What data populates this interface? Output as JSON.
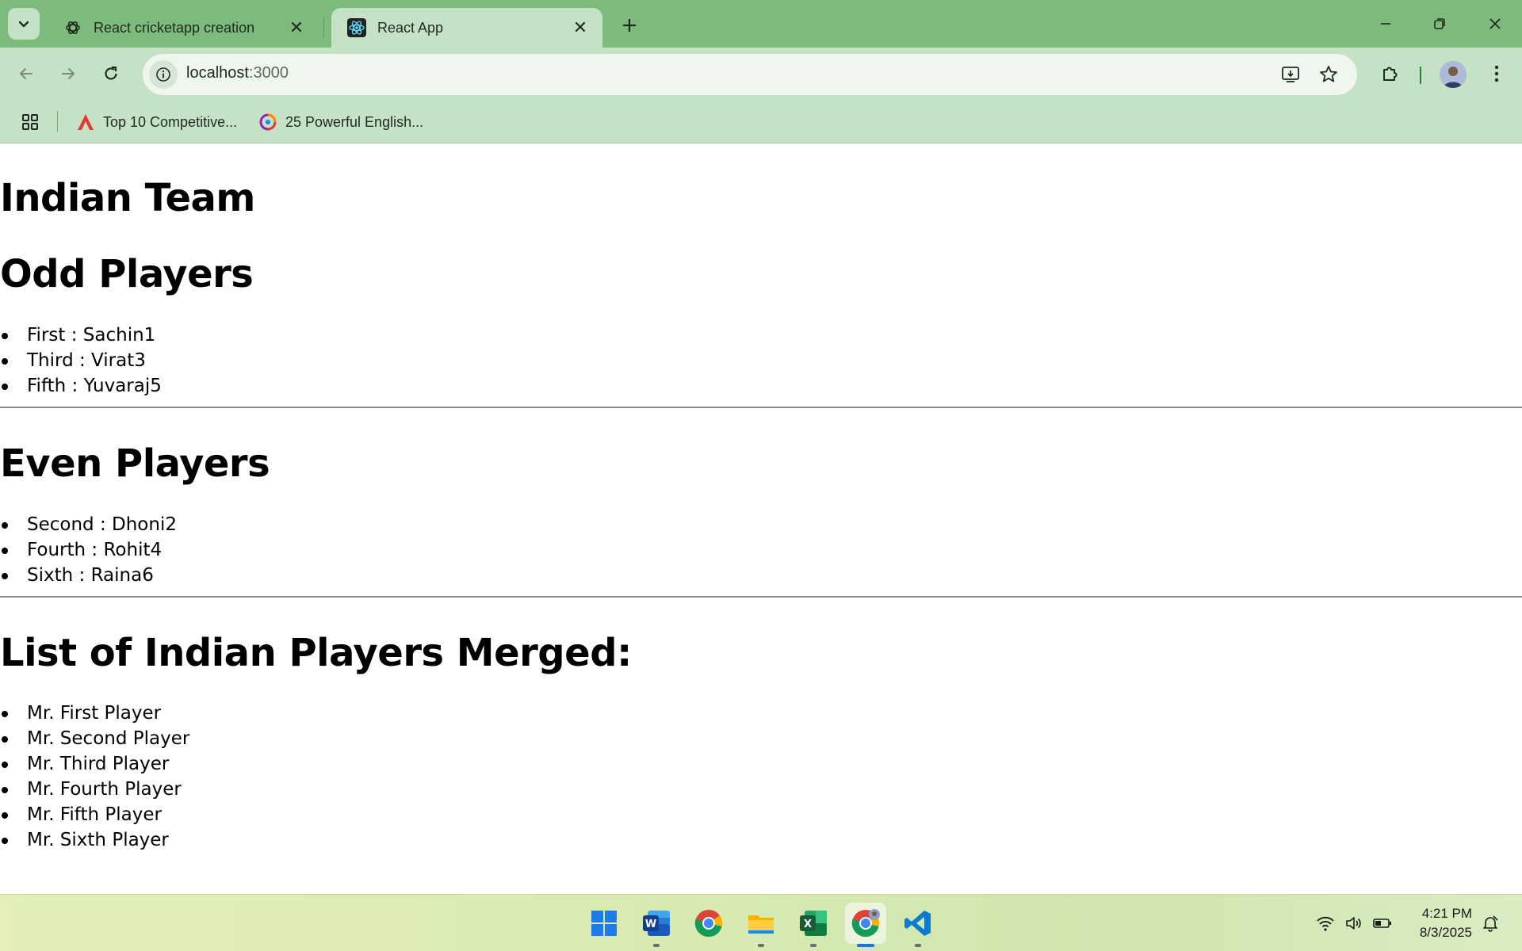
{
  "browser": {
    "tabs": [
      {
        "title": "React cricketapp creation",
        "favicon": "openai-icon",
        "active": false
      },
      {
        "title": "React App",
        "favicon": "react-icon",
        "active": true
      }
    ],
    "address": {
      "host": "localhost",
      "port": ":3000"
    },
    "bookmarks": [
      {
        "label": "Top 10 Competitive...",
        "icon": "red-a-logo-icon"
      },
      {
        "label": "25 Powerful English...",
        "icon": "colorful-logo-icon"
      }
    ]
  },
  "page": {
    "title": "Indian Team",
    "odd": {
      "heading": "Odd Players",
      "items": [
        "First : Sachin1",
        "Third : Virat3",
        "Fifth : Yuvaraj5"
      ]
    },
    "even": {
      "heading": "Even Players",
      "items": [
        "Second : Dhoni2",
        "Fourth : Rohit4",
        "Sixth : Raina6"
      ]
    },
    "merged": {
      "heading": "List of Indian Players Merged:",
      "items": [
        "Mr. First Player",
        "Mr. Second Player",
        "Mr. Third Player",
        "Mr. Fourth Player",
        "Mr. Fifth Player",
        "Mr. Sixth Player"
      ]
    }
  },
  "taskbar": {
    "apps": [
      "windows-start-icon",
      "word-icon",
      "chrome-icon",
      "file-explorer-icon",
      "excel-icon",
      "chrome-profile-icon",
      "vscode-icon"
    ],
    "time": "4:21 PM",
    "date": "8/3/2025"
  },
  "colors": {
    "tabstrip": "#7dbb7d",
    "toolbar": "#c6e2c6",
    "omnibox": "#eef6ee"
  }
}
